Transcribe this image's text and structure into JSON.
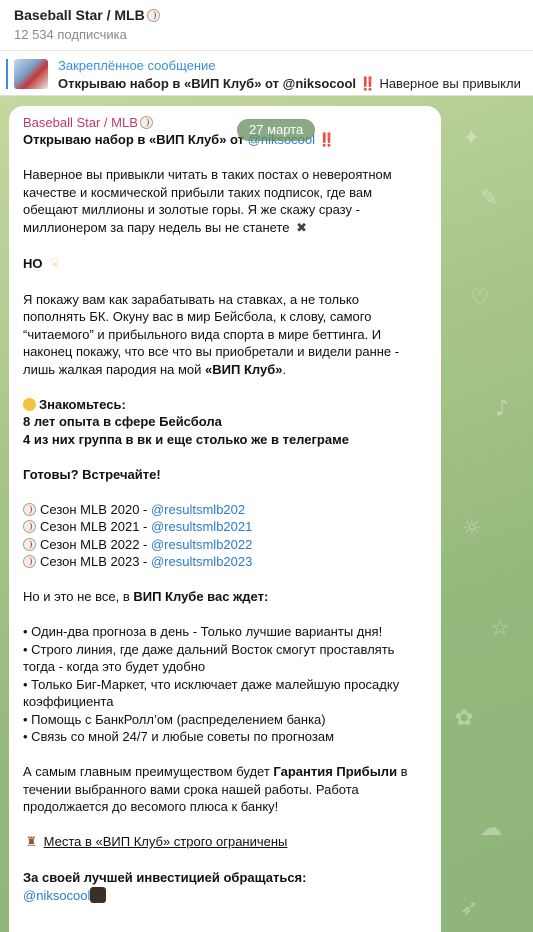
{
  "header": {
    "title": "Baseball Star / MLB",
    "title_icon": "baseball-icon",
    "subscribers": "12 534 подписчика"
  },
  "pinned": {
    "label": "Закреплённое сообщение",
    "text_bold": "Открываю набор в «ВИП Клуб» от @niksocool",
    "text_emoji": "‼️",
    "text_rest": "Наверное вы привыкли"
  },
  "message": {
    "channel": "Baseball Star / MLB",
    "date": "27 марта",
    "title_prefix": "Открываю набор в «ВИП Клуб» от ",
    "title_link": "@niksocool",
    "p1": [
      "Наверное вы привыкли читать в таких постах о невероятном",
      "качестве и космической прибыли таких подписок, где вам",
      "обещают миллионы и золотые горы. Я же скажу сразу -",
      "миллионером за пару недель вы не станете"
    ],
    "but": "НО",
    "p2": [
      "Я покажу вам как зарабатывать на ставках, а не только",
      "пополнять БК. Окуну вас в мир Бейсбола, к слову, самого",
      "“читаемого” и прибыльного вида спорта в мире беттинга. И",
      "наконец покажу, что все что вы приобретали и видели ранне -"
    ],
    "p2_last_prefix": "лишь жалкая пародия на мой ",
    "p2_last_bold": "«ВИП Клуб»",
    "p2_last_suffix": ".",
    "meet": "Знакомьтесь:",
    "exp1": "8 лет опыта в сфере Бейсбола",
    "exp2": "4 из них группа в вк и еще столько же в телеграме",
    "ready": "Готовы? Встречайте!",
    "seasons": [
      {
        "label": "Сезон MLB 2020 - ",
        "link": "@resultsmlb202"
      },
      {
        "label": "Сезон MLB 2021 - ",
        "link": "@resultsmlb2021"
      },
      {
        "label": "Сезон MLB 2022 - ",
        "link": "@resultsmlb2022"
      },
      {
        "label": "Сезон MLB 2023 - ",
        "link": "@resultsmlb2023"
      }
    ],
    "more_prefix": "Но и это не все, в ",
    "more_bold": "ВИП Клубе вас ждет:",
    "bullets": [
      "• Один-два прогноза в день - Только лучшие варианты дня!",
      "• Строго линия, где даже дальний Восток смогут проставлять",
      "тогда - когда это будет удобно",
      "• Только Биг-Маркет, что исключает даже малейшую просадку",
      "коэффициента",
      "• Помощь с БанкРолл’ом (распределением банка)",
      "• Связь со мной 24/7 и любые советы по прогнозам"
    ],
    "main_prefix": "А самым главным преимуществом будет ",
    "main_bold": "Гарантия Прибыли",
    "main_suffix": " в",
    "main_rest": [
      "течении выбранного вами срока нашей работы. Работа",
      "продолжается до весомого плюса к банку!"
    ],
    "places": "Места в «ВИП Клуб» строго ограничены",
    "contact": "За своей лучшей инвестицией обращаться:",
    "contact_link": "@niksocool"
  },
  "colors": {
    "link": "#2a7bd0",
    "channel_name": "#c0396b",
    "pinned_accent": "#3a8fd8",
    "chat_bg": "#a9c68a"
  }
}
